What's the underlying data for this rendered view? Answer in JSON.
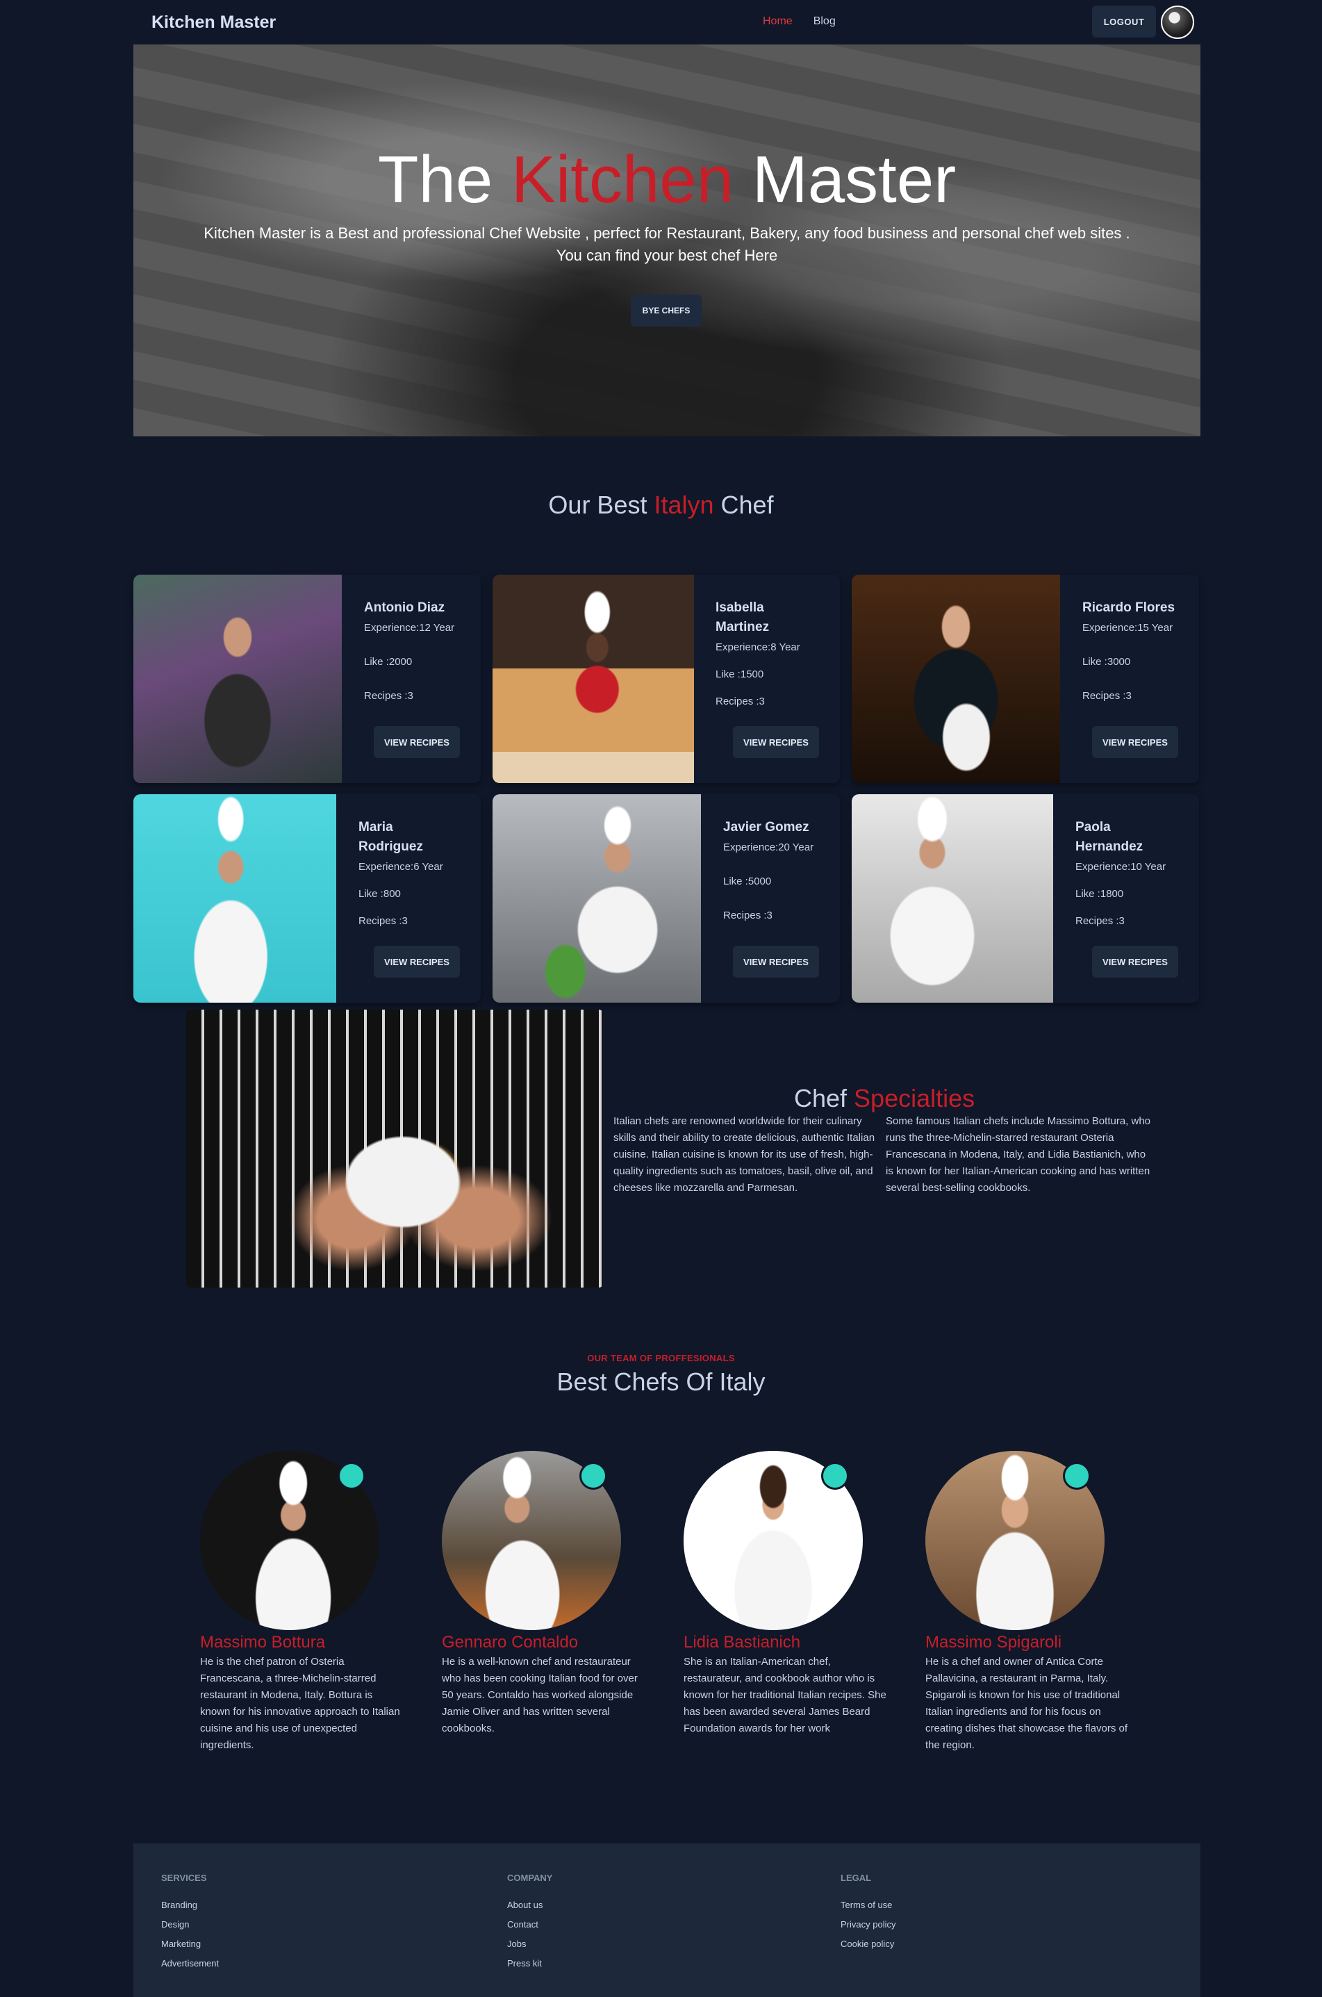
{
  "nav": {
    "brand": "Kitchen Master",
    "links": [
      "Home",
      "Blog"
    ],
    "logout": "LOGOUT"
  },
  "hero": {
    "title_a": "The ",
    "title_b": "Kitchen",
    "title_c": " Master",
    "subtitle_line1": "Kitchen Master is a Best and professional Chef Website , perfect for Restaurant, Bakery, any food business and personal chef web sites .",
    "subtitle_line2": "You can find your best chef Here",
    "button": "BYE CHEFS"
  },
  "best": {
    "heading_a": "Our Best ",
    "heading_b": "Italyn",
    "heading_c": " Chef"
  },
  "chefs": [
    {
      "name": "Antonio Diaz",
      "experience": "Experience:12 Year",
      "likes": "Like :2000",
      "recipes": "Recipes :3",
      "button": "VIEW RECIPES"
    },
    {
      "name": "Isabella Martinez",
      "experience": "Experience:8 Year",
      "likes": "Like :1500",
      "recipes": "Recipes :3",
      "button": "VIEW RECIPES"
    },
    {
      "name": "Ricardo Flores",
      "experience": "Experience:15 Year",
      "likes": "Like :3000",
      "recipes": "Recipes :3",
      "button": "VIEW RECIPES"
    },
    {
      "name": "Maria Rodriguez",
      "experience": "Experience:6 Year",
      "likes": "Like :800",
      "recipes": "Recipes :3",
      "button": "VIEW RECIPES"
    },
    {
      "name": "Javier Gomez",
      "experience": "Experience:20 Year",
      "likes": "Like :5000",
      "recipes": "Recipes :3",
      "button": "VIEW RECIPES"
    },
    {
      "name": "Paola Hernandez",
      "experience": "Experience:10 Year",
      "likes": "Like :1800",
      "recipes": "Recipes :3",
      "button": "VIEW RECIPES"
    }
  ],
  "specialties": {
    "title_a": "Chef ",
    "title_b": "Specialties",
    "para1": "Italian chefs are renowned worldwide for their culinary skills and their ability to create delicious, authentic Italian cuisine. Italian cuisine is known for its use of fresh, high-quality ingredients such as tomatoes, basil, olive oil, and cheeses like mozzarella and Parmesan.",
    "para2": "Some famous Italian chefs include Massimo Bottura, who runs the three-Michelin-starred restaurant Osteria Francescana in Modena, Italy, and Lidia Bastianich, who is known for her Italian-American cooking and has written several best-selling cookbooks."
  },
  "team": {
    "kicker": "OUR TEAM OF PROFFESIONALS",
    "heading": "Best Chefs Of Italy",
    "members": [
      {
        "name": "Massimo Bottura",
        "bio": "He is the chef patron of Osteria Francescana, a three-Michelin-starred restaurant in Modena, Italy. Bottura is known for his innovative approach to Italian cuisine and his use of unexpected ingredients."
      },
      {
        "name": "Gennaro Contaldo",
        "bio": "He is a well-known chef and restaurateur who has been cooking Italian food for over 50 years. Contaldo has worked alongside Jamie Oliver and has written several cookbooks."
      },
      {
        "name": "Lidia Bastianich",
        "bio": "She is an Italian-American chef, restaurateur, and cookbook author who is known for her traditional Italian recipes. She has been awarded several James Beard Foundation awards for her work"
      },
      {
        "name": "Massimo Spigaroli",
        "bio": "He is a chef and owner of Antica Corte Pallavicina, a restaurant in Parma, Italy. Spigaroli is known for his use of traditional Italian ingredients and for his focus on creating dishes that showcase the flavors of the region."
      }
    ]
  },
  "footer": {
    "services": {
      "heading": "SERVICES",
      "links": [
        "Branding",
        "Design",
        "Marketing",
        "Advertisement"
      ]
    },
    "company": {
      "heading": "COMPANY",
      "links": [
        "About us",
        "Contact",
        "Jobs",
        "Press kit"
      ]
    },
    "legal": {
      "heading": "LEGAL",
      "links": [
        "Terms of use",
        "Privacy policy",
        "Cookie policy"
      ]
    }
  }
}
